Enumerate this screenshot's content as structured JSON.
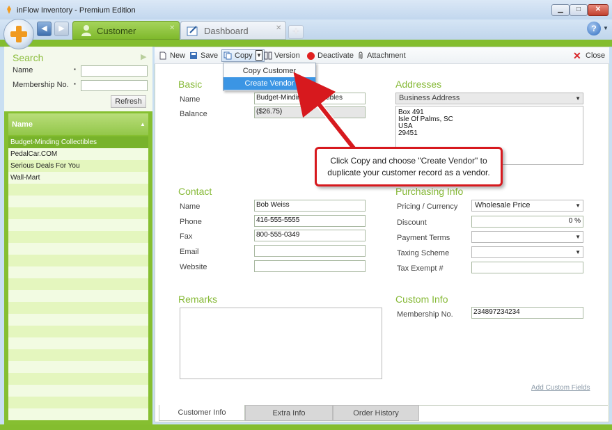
{
  "window": {
    "title": "inFlow Inventory - Premium Edition"
  },
  "tabs": [
    {
      "label": "Customer",
      "active": true
    },
    {
      "label": "Dashboard",
      "active": false
    }
  ],
  "search": {
    "header": "Search",
    "name_label": "Name",
    "name_value": "",
    "membership_label": "Membership No.",
    "membership_value": "",
    "refresh_label": "Refresh"
  },
  "list": {
    "header": "Name",
    "rows": [
      "Budget-Minding Collectibles",
      "PedalCar.COM",
      "Serious Deals For You",
      "Wall-Mart"
    ],
    "selected_index": 0
  },
  "toolbar": {
    "new": "New",
    "save": "Save",
    "copy": "Copy",
    "version": "Version",
    "deactivate": "Deactivate",
    "attachment": "Attachment",
    "close": "Close"
  },
  "copy_menu": {
    "items": [
      "Copy Customer",
      "Create Vendor"
    ],
    "highlighted": 1
  },
  "basic": {
    "title": "Basic",
    "name_label": "Name",
    "name_value": "Budget-Minding Collectibles",
    "balance_label": "Balance",
    "balance_value": "($26.75)"
  },
  "addresses": {
    "title": "Addresses",
    "type": "Business Address",
    "lines": [
      "Box 491",
      "Isle Of Palms, SC",
      "USA",
      "29451"
    ]
  },
  "contact": {
    "title": "Contact",
    "name_label": "Name",
    "name_value": "Bob Weiss",
    "phone_label": "Phone",
    "phone_value": "416-555-5555",
    "fax_label": "Fax",
    "fax_value": "800-555-0349",
    "email_label": "Email",
    "email_value": "",
    "website_label": "Website",
    "website_value": ""
  },
  "purchasing": {
    "title": "Purchasing Info",
    "pricing_label": "Pricing / Currency",
    "pricing_value": "Wholesale Price",
    "discount_label": "Discount",
    "discount_value": "0 %",
    "terms_label": "Payment Terms",
    "terms_value": "",
    "taxing_label": "Taxing Scheme",
    "taxing_value": "",
    "exempt_label": "Tax Exempt #",
    "exempt_value": ""
  },
  "remarks": {
    "title": "Remarks",
    "value": ""
  },
  "custom": {
    "title": "Custom Info",
    "membership_label": "Membership No.",
    "membership_value": "234897234234",
    "add_link": "Add Custom Fields"
  },
  "bottom_tabs": [
    "Customer Info",
    "Extra Info",
    "Order History"
  ],
  "callout": {
    "text": "Click Copy and choose \"Create Vendor\" to duplicate your customer record as a vendor."
  },
  "colors": {
    "accent_green": "#84bd2f",
    "callout_red": "#d7191e",
    "menu_highlight": "#3b95e4"
  }
}
